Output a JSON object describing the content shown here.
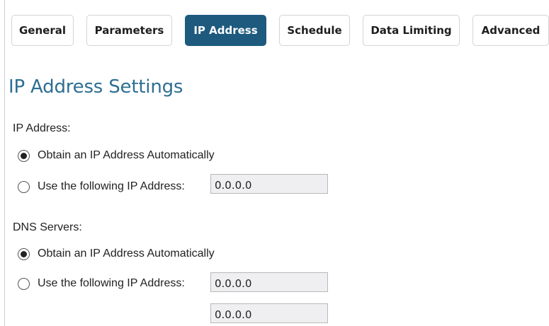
{
  "tabs": [
    {
      "label": "General",
      "active": false
    },
    {
      "label": "Parameters",
      "active": false
    },
    {
      "label": "IP Address",
      "active": true
    },
    {
      "label": "Schedule",
      "active": false
    },
    {
      "label": "Data Limiting",
      "active": false
    },
    {
      "label": "Advanced",
      "active": false
    }
  ],
  "section_title": "IP Address Settings",
  "ip_address": {
    "label": "IP Address:",
    "auto_label": "Obtain an IP Address Automatically",
    "auto_selected": true,
    "manual_label": "Use the following IP Address:",
    "manual_value": "0.0.0.0"
  },
  "dns_servers": {
    "label": "DNS Servers:",
    "auto_label": "Obtain an IP Address Automatically",
    "auto_selected": true,
    "manual_label": "Use the following IP Address:",
    "primary_value": "0.0.0.0",
    "secondary_value": "0.0.0.0"
  },
  "colors": {
    "accent": "#1d5a7e",
    "title": "#2e6e93",
    "field_bg": "#efeff1"
  }
}
